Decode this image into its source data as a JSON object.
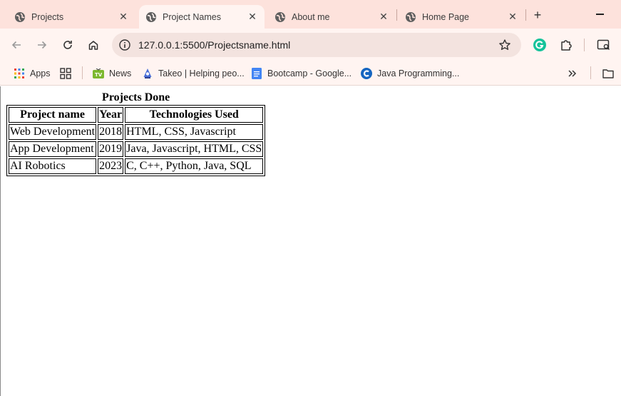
{
  "browser": {
    "tabs": [
      {
        "title": "Projects",
        "active": false
      },
      {
        "title": "Project Names",
        "active": true
      },
      {
        "title": "About me",
        "active": false
      },
      {
        "title": "Home Page",
        "active": false
      }
    ],
    "url": "127.0.0.1:5500/Projectsname.html",
    "bookmarks": [
      {
        "label": "Apps",
        "icon": "apps-grid-icon"
      },
      {
        "label": "",
        "icon": "tab-groups-icon"
      },
      {
        "label": "News",
        "icon": "tv-news-icon"
      },
      {
        "label": "Takeo | Helping peo...",
        "icon": "takeo-icon"
      },
      {
        "label": "Bootcamp - Google...",
        "icon": "google-docs-icon"
      },
      {
        "label": "Java Programming...",
        "icon": "java-c-icon"
      }
    ],
    "colors": {
      "tabstrip": "#fde2dc",
      "toolbar": "#fff4f1",
      "omnibox": "#f3e3df"
    }
  },
  "page": {
    "caption": "Projects Done",
    "headers": [
      "Project name",
      "Year",
      "Technologies Used"
    ],
    "rows": [
      [
        "Web Development",
        "2018",
        "HTML, CSS, Javascript"
      ],
      [
        "App Development",
        "2019",
        "Java, Javascript, HTML, CSS"
      ],
      [
        "AI Robotics",
        "2023",
        "C, C++, Python, Java, SQL"
      ]
    ]
  }
}
